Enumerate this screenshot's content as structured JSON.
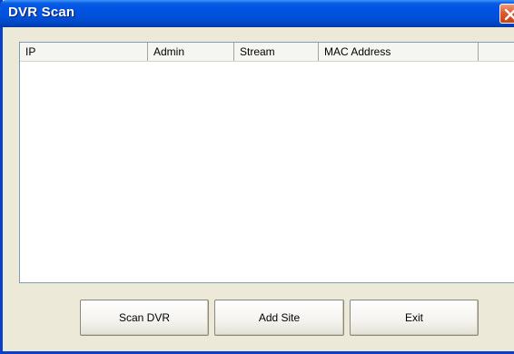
{
  "window": {
    "title": "DVR Scan"
  },
  "list": {
    "columns": [
      "IP",
      "Admin",
      "Stream",
      "MAC Address",
      ""
    ],
    "rows": []
  },
  "buttons": {
    "scan_label": "Scan DVR",
    "add_label": "Add Site",
    "exit_label": "Exit"
  },
  "icons": {
    "close": "close-icon"
  },
  "colors": {
    "titlebar": "#0054e3",
    "close": "#e05a2c",
    "frame": "#ece9d8"
  }
}
